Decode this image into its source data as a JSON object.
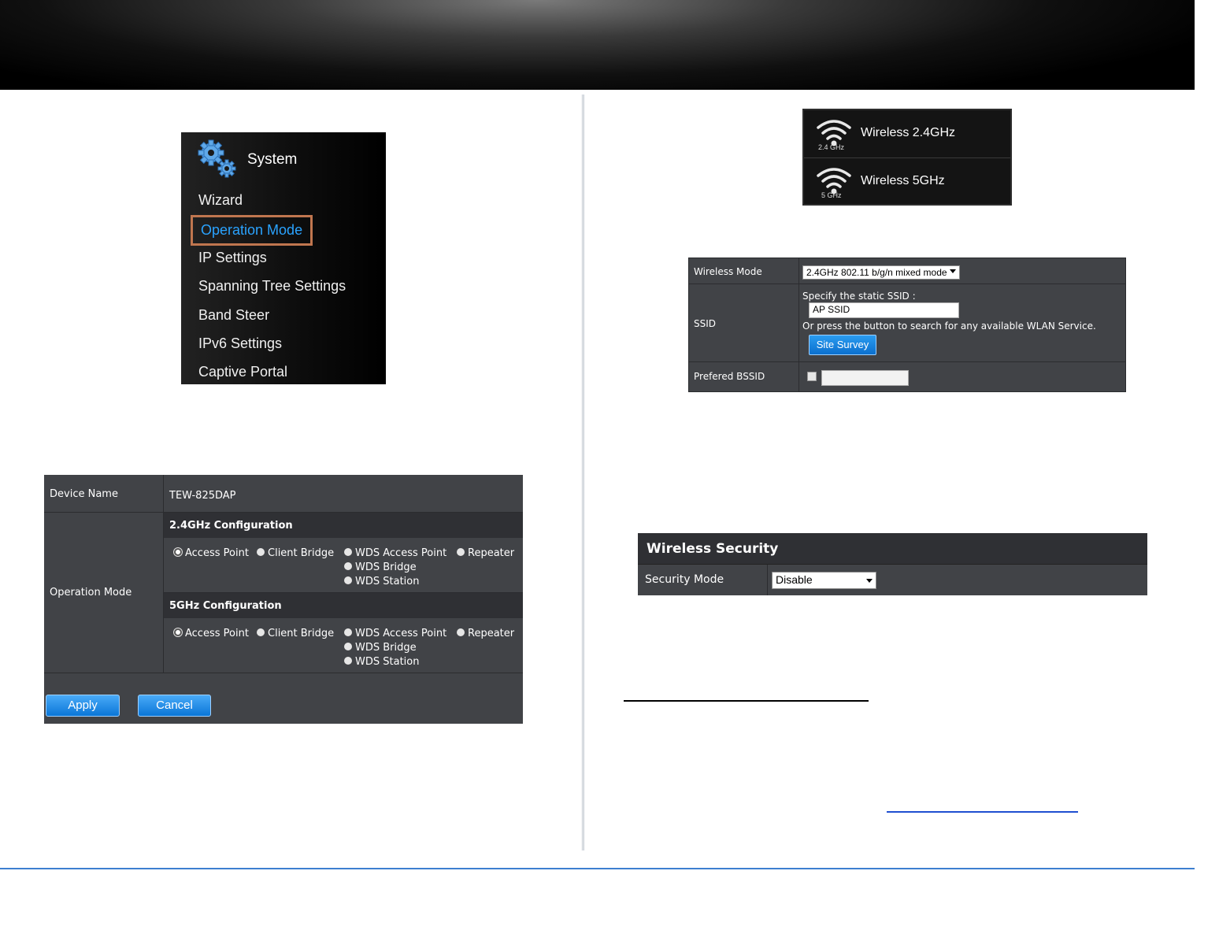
{
  "system_menu": {
    "title": "System",
    "items": [
      "Wizard",
      "Operation Mode",
      "IP Settings",
      "Spanning Tree Settings",
      "Band Steer",
      "IPv6 Settings",
      "Captive Portal"
    ],
    "active_index": 1,
    "active_color": "#2aa3ff",
    "highlight_border": "#c0764f"
  },
  "operation_form": {
    "device_name_label": "Device Name",
    "device_name_value": "TEW-825DAP",
    "operation_mode_label": "Operation Mode",
    "band_24": {
      "title": "2.4GHz Configuration",
      "options": [
        "Access Point",
        "Client Bridge",
        "WDS Access Point",
        "Repeater",
        "WDS Bridge",
        "WDS Station"
      ],
      "selected": "Access Point"
    },
    "band_5": {
      "title": "5GHz Configuration",
      "options": [
        "Access Point",
        "Client Bridge",
        "WDS Access Point",
        "Repeater",
        "WDS Bridge",
        "WDS Station"
      ],
      "selected": "Access Point"
    },
    "apply_label": "Apply",
    "cancel_label": "Cancel"
  },
  "wireless_menu": {
    "items": [
      {
        "label": "Wireless 2.4GHz",
        "band": "2.4 GHz",
        "icon": "wifi-icon"
      },
      {
        "label": "Wireless 5GHz",
        "band": "5 GHz",
        "icon": "wifi-icon"
      }
    ]
  },
  "wireless_settings": {
    "mode_label": "Wireless Mode",
    "mode_value": "2.4GHz 802.11 b/g/n mixed mode",
    "ssid_label": "SSID",
    "ssid_hint": "Specify the static SSID :",
    "ssid_value": "AP SSID",
    "ssid_search_hint": "Or press the button to search for any available WLAN Service.",
    "site_survey_label": "Site Survey",
    "bssid_label": "Prefered BSSID",
    "bssid_value": ""
  },
  "wireless_security": {
    "title": "Wireless Security",
    "mode_label": "Security Mode",
    "mode_value": "Disable"
  },
  "colors": {
    "panel_bg": "#414347",
    "header_bg": "#2f3034",
    "button_blue": "#0a76d8",
    "footer_rule": "#3d7fd0"
  }
}
